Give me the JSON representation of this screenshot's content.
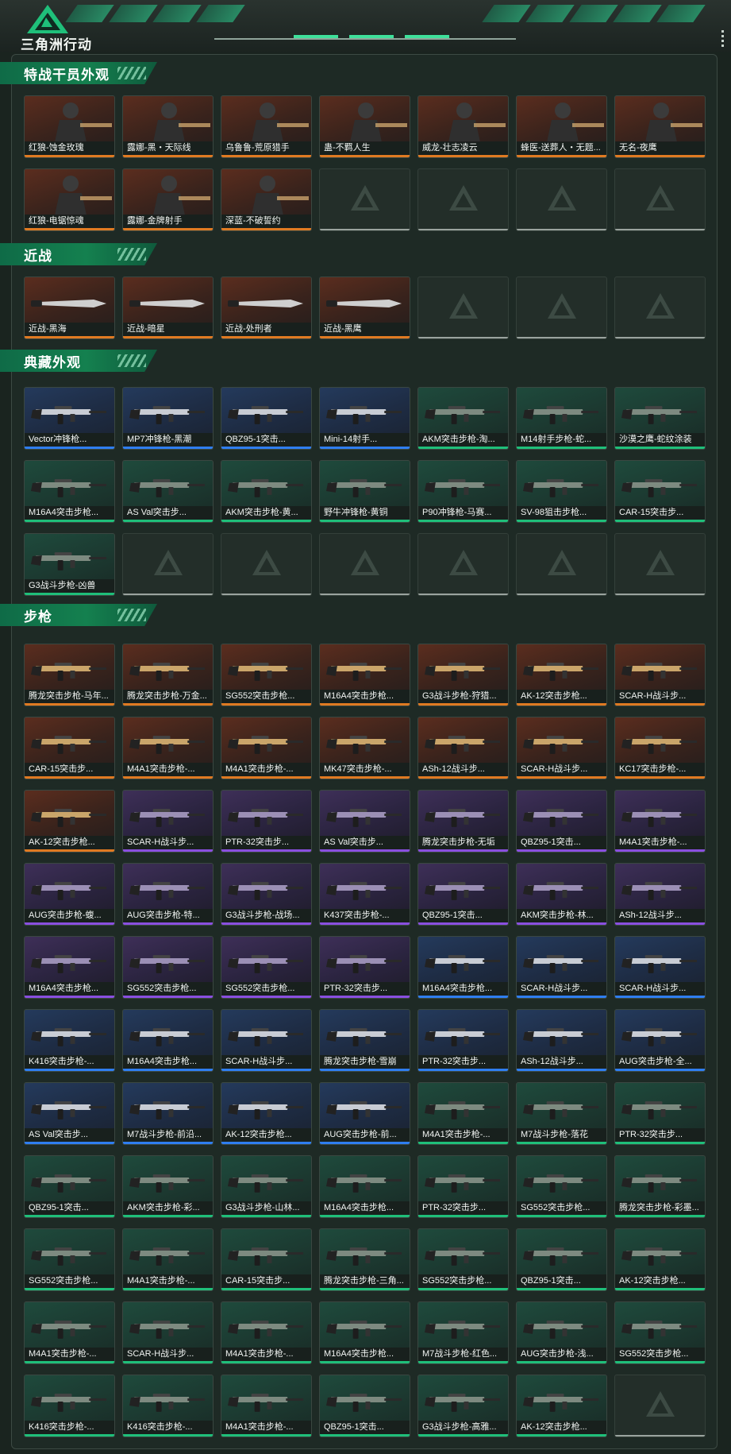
{
  "brand": "三角洲行动",
  "sections": [
    {
      "title": "特战干员外观",
      "items": [
        {
          "label": "红狼-蚀金玫瑰",
          "quality": "gold",
          "kind": "operator"
        },
        {
          "label": "露娜-黑・天际线",
          "quality": "gold",
          "kind": "operator"
        },
        {
          "label": "乌鲁鲁-荒原猎手",
          "quality": "gold",
          "kind": "operator"
        },
        {
          "label": "蛊-不羁人生",
          "quality": "gold",
          "kind": "operator"
        },
        {
          "label": "威龙-壮志凌云",
          "quality": "gold",
          "kind": "operator"
        },
        {
          "label": "蜂医-送葬人・无题...",
          "quality": "gold",
          "kind": "operator"
        },
        {
          "label": "无名-夜鹰",
          "quality": "gold",
          "kind": "operator"
        },
        {
          "label": "红狼-电锯惊魂",
          "quality": "gold",
          "kind": "operator"
        },
        {
          "label": "露娜-金牌射手",
          "quality": "gold",
          "kind": "operator"
        },
        {
          "label": "深蓝-不破誓约",
          "quality": "gold",
          "kind": "operator"
        },
        {
          "label": "",
          "quality": "empty"
        },
        {
          "label": "",
          "quality": "empty"
        },
        {
          "label": "",
          "quality": "empty"
        },
        {
          "label": "",
          "quality": "empty"
        }
      ]
    },
    {
      "title": "近战",
      "items": [
        {
          "label": "近战-黑海",
          "quality": "gold",
          "kind": "melee"
        },
        {
          "label": "近战-暗星",
          "quality": "gold",
          "kind": "melee"
        },
        {
          "label": "近战-处刑者",
          "quality": "gold",
          "kind": "melee"
        },
        {
          "label": "近战-黑鹰",
          "quality": "gold",
          "kind": "melee"
        },
        {
          "label": "",
          "quality": "empty"
        },
        {
          "label": "",
          "quality": "empty"
        },
        {
          "label": "",
          "quality": "empty"
        }
      ]
    },
    {
      "title": "典藏外观",
      "items": [
        {
          "label": "Vector冲锋枪...",
          "quality": "blue",
          "kind": "gun"
        },
        {
          "label": "MP7冲锋枪-黑潮",
          "quality": "blue",
          "kind": "gun"
        },
        {
          "label": "QBZ95-1突击...",
          "quality": "blue",
          "kind": "gun"
        },
        {
          "label": "Mini-14射手...",
          "quality": "blue",
          "kind": "gun"
        },
        {
          "label": "AKM突击步枪-淘...",
          "quality": "green",
          "kind": "gun"
        },
        {
          "label": "M14射手步枪-蛇...",
          "quality": "green",
          "kind": "gun"
        },
        {
          "label": "沙漠之鹰-蛇纹涂装",
          "quality": "green",
          "kind": "gun"
        },
        {
          "label": "M16A4突击步枪...",
          "quality": "green",
          "kind": "gun"
        },
        {
          "label": "AS Val突击步...",
          "quality": "green",
          "kind": "gun"
        },
        {
          "label": "AKM突击步枪-黄...",
          "quality": "green",
          "kind": "gun"
        },
        {
          "label": "野牛冲锋枪-黄铜",
          "quality": "green",
          "kind": "gun"
        },
        {
          "label": "P90冲锋枪-马赛...",
          "quality": "green",
          "kind": "gun"
        },
        {
          "label": "SV-98狙击步枪...",
          "quality": "green",
          "kind": "gun"
        },
        {
          "label": "CAR-15突击步...",
          "quality": "green",
          "kind": "gun"
        },
        {
          "label": "G3战斗步枪-凶兽",
          "quality": "green",
          "kind": "gun"
        },
        {
          "label": "",
          "quality": "empty"
        },
        {
          "label": "",
          "quality": "empty"
        },
        {
          "label": "",
          "quality": "empty"
        },
        {
          "label": "",
          "quality": "empty"
        },
        {
          "label": "",
          "quality": "empty"
        },
        {
          "label": "",
          "quality": "empty"
        }
      ]
    },
    {
      "title": "步枪",
      "items": [
        {
          "label": "腾龙突击步枪-马年...",
          "quality": "gold",
          "kind": "gun"
        },
        {
          "label": "腾龙突击步枪-万金...",
          "quality": "gold",
          "kind": "gun"
        },
        {
          "label": "SG552突击步枪...",
          "quality": "gold",
          "kind": "gun"
        },
        {
          "label": "M16A4突击步枪...",
          "quality": "gold",
          "kind": "gun"
        },
        {
          "label": "G3战斗步枪-狩猎...",
          "quality": "gold",
          "kind": "gun"
        },
        {
          "label": "AK-12突击步枪...",
          "quality": "gold",
          "kind": "gun"
        },
        {
          "label": "SCAR-H战斗步...",
          "quality": "gold",
          "kind": "gun"
        },
        {
          "label": "CAR-15突击步...",
          "quality": "gold",
          "kind": "gun"
        },
        {
          "label": "M4A1突击步枪-...",
          "quality": "gold",
          "kind": "gun"
        },
        {
          "label": "M4A1突击步枪-...",
          "quality": "gold",
          "kind": "gun"
        },
        {
          "label": "MK47突击步枪-...",
          "quality": "gold",
          "kind": "gun"
        },
        {
          "label": "ASh-12战斗步...",
          "quality": "gold",
          "kind": "gun"
        },
        {
          "label": "SCAR-H战斗步...",
          "quality": "gold",
          "kind": "gun"
        },
        {
          "label": "KC17突击步枪-...",
          "quality": "gold",
          "kind": "gun"
        },
        {
          "label": "AK-12突击步枪...",
          "quality": "gold",
          "kind": "gun"
        },
        {
          "label": "SCAR-H战斗步...",
          "quality": "purple",
          "kind": "gun"
        },
        {
          "label": "PTR-32突击步...",
          "quality": "purple",
          "kind": "gun"
        },
        {
          "label": "AS Val突击步...",
          "quality": "purple",
          "kind": "gun"
        },
        {
          "label": "腾龙突击步枪-无垢",
          "quality": "purple",
          "kind": "gun"
        },
        {
          "label": "QBZ95-1突击...",
          "quality": "purple",
          "kind": "gun"
        },
        {
          "label": "M4A1突击步枪-...",
          "quality": "purple",
          "kind": "gun"
        },
        {
          "label": "AUG突击步枪-蝮...",
          "quality": "purple",
          "kind": "gun"
        },
        {
          "label": "AUG突击步枪-特...",
          "quality": "purple",
          "kind": "gun"
        },
        {
          "label": "G3战斗步枪-战场...",
          "quality": "purple",
          "kind": "gun"
        },
        {
          "label": "K437突击步枪-...",
          "quality": "purple",
          "kind": "gun"
        },
        {
          "label": "QBZ95-1突击...",
          "quality": "purple",
          "kind": "gun"
        },
        {
          "label": "AKM突击步枪-林...",
          "quality": "purple",
          "kind": "gun"
        },
        {
          "label": "ASh-12战斗步...",
          "quality": "purple",
          "kind": "gun"
        },
        {
          "label": "M16A4突击步枪...",
          "quality": "purple",
          "kind": "gun"
        },
        {
          "label": "SG552突击步枪...",
          "quality": "purple",
          "kind": "gun"
        },
        {
          "label": "SG552突击步枪...",
          "quality": "purple",
          "kind": "gun"
        },
        {
          "label": "PTR-32突击步...",
          "quality": "purple",
          "kind": "gun"
        },
        {
          "label": "M16A4突击步枪...",
          "quality": "blue",
          "kind": "gun"
        },
        {
          "label": "SCAR-H战斗步...",
          "quality": "blue",
          "kind": "gun"
        },
        {
          "label": "SCAR-H战斗步...",
          "quality": "blue",
          "kind": "gun"
        },
        {
          "label": "K416突击步枪-...",
          "quality": "blue",
          "kind": "gun"
        },
        {
          "label": "M16A4突击步枪...",
          "quality": "blue",
          "kind": "gun"
        },
        {
          "label": "SCAR-H战斗步...",
          "quality": "blue",
          "kind": "gun"
        },
        {
          "label": "腾龙突击步枪-雪崩",
          "quality": "blue",
          "kind": "gun"
        },
        {
          "label": "PTR-32突击步...",
          "quality": "blue",
          "kind": "gun"
        },
        {
          "label": "ASh-12战斗步...",
          "quality": "blue",
          "kind": "gun"
        },
        {
          "label": "AUG突击步枪-全...",
          "quality": "blue",
          "kind": "gun"
        },
        {
          "label": "AS Val突击步...",
          "quality": "blue",
          "kind": "gun"
        },
        {
          "label": "M7战斗步枪-前沿...",
          "quality": "blue",
          "kind": "gun"
        },
        {
          "label": "AK-12突击步枪...",
          "quality": "blue",
          "kind": "gun"
        },
        {
          "label": "AUG突击步枪-前...",
          "quality": "blue",
          "kind": "gun"
        },
        {
          "label": "M4A1突击步枪-...",
          "quality": "green",
          "kind": "gun"
        },
        {
          "label": "M7战斗步枪-落花",
          "quality": "green",
          "kind": "gun"
        },
        {
          "label": "PTR-32突击步...",
          "quality": "green",
          "kind": "gun"
        },
        {
          "label": "QBZ95-1突击...",
          "quality": "green",
          "kind": "gun"
        },
        {
          "label": "AKM突击步枪-彩...",
          "quality": "green",
          "kind": "gun"
        },
        {
          "label": "G3战斗步枪-山林...",
          "quality": "green",
          "kind": "gun"
        },
        {
          "label": "M16A4突击步枪...",
          "quality": "green",
          "kind": "gun"
        },
        {
          "label": "PTR-32突击步...",
          "quality": "green",
          "kind": "gun"
        },
        {
          "label": "SG552突击步枪...",
          "quality": "green",
          "kind": "gun"
        },
        {
          "label": "腾龙突击步枪-彩墨...",
          "quality": "green",
          "kind": "gun"
        },
        {
          "label": "SG552突击步枪...",
          "quality": "green",
          "kind": "gun"
        },
        {
          "label": "M4A1突击步枪-...",
          "quality": "green",
          "kind": "gun"
        },
        {
          "label": "CAR-15突击步...",
          "quality": "green",
          "kind": "gun"
        },
        {
          "label": "腾龙突击步枪-三角...",
          "quality": "green",
          "kind": "gun"
        },
        {
          "label": "SG552突击步枪...",
          "quality": "green",
          "kind": "gun"
        },
        {
          "label": "QBZ95-1突击...",
          "quality": "green",
          "kind": "gun"
        },
        {
          "label": "AK-12突击步枪...",
          "quality": "green",
          "kind": "gun"
        },
        {
          "label": "M4A1突击步枪-...",
          "quality": "green",
          "kind": "gun"
        },
        {
          "label": "SCAR-H战斗步...",
          "quality": "green",
          "kind": "gun"
        },
        {
          "label": "M4A1突击步枪-...",
          "quality": "green",
          "kind": "gun"
        },
        {
          "label": "M16A4突击步枪...",
          "quality": "green",
          "kind": "gun"
        },
        {
          "label": "M7战斗步枪-红色...",
          "quality": "green",
          "kind": "gun"
        },
        {
          "label": "AUG突击步枪-浅...",
          "quality": "green",
          "kind": "gun"
        },
        {
          "label": "SG552突击步枪...",
          "quality": "green",
          "kind": "gun"
        },
        {
          "label": "K416突击步枪-...",
          "quality": "green",
          "kind": "gun"
        },
        {
          "label": "K416突击步枪-...",
          "quality": "green",
          "kind": "gun"
        },
        {
          "label": "M4A1突击步枪-...",
          "quality": "green",
          "kind": "gun"
        },
        {
          "label": "QBZ95-1突击...",
          "quality": "green",
          "kind": "gun"
        },
        {
          "label": "G3战斗步枪-高雅...",
          "quality": "green",
          "kind": "gun"
        },
        {
          "label": "AK-12突击步枪...",
          "quality": "green",
          "kind": "gun"
        },
        {
          "label": "",
          "quality": "empty"
        }
      ]
    }
  ],
  "colors": {
    "gold": "#e07a22",
    "purple": "#8a4fe0",
    "blue": "#2f7ef0",
    "green": "#1fbf7a",
    "accent": "#14804f"
  }
}
